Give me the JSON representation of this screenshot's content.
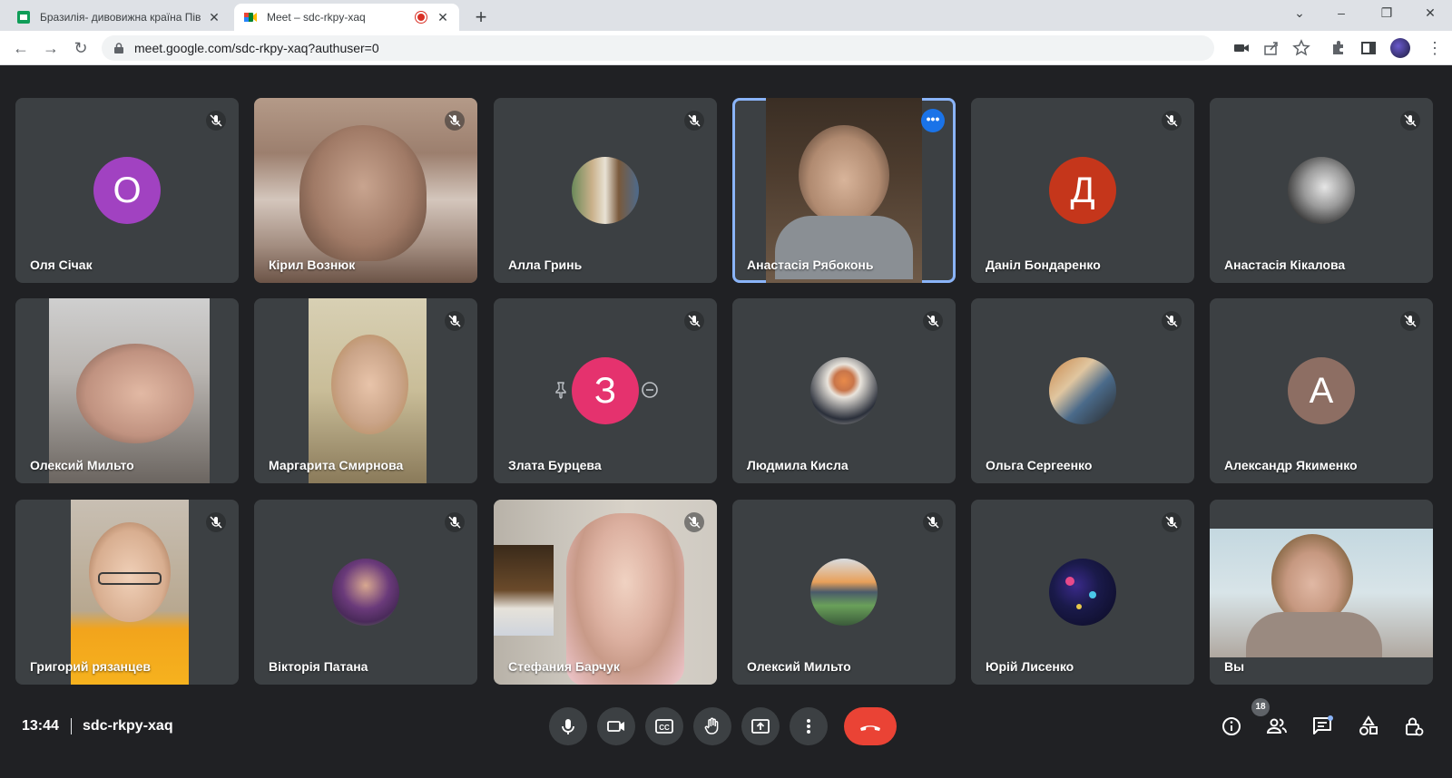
{
  "browser": {
    "tabs": [
      {
        "title": "Бразилія- дивовижна країна Пів",
        "active": false
      },
      {
        "title": "Meet – sdc-rkpy-xaq",
        "active": true
      }
    ],
    "url": "meet.google.com/sdc-rkpy-xaq?authuser=0"
  },
  "participants": [
    {
      "name": "Оля Січак",
      "type": "letter",
      "letter": "О",
      "color": "#a142c1",
      "muted": true
    },
    {
      "name": "Кірил Вознюк",
      "type": "video",
      "muted": true
    },
    {
      "name": "Алла Гринь",
      "type": "photo",
      "muted": true
    },
    {
      "name": "Анастасія Рябоконь",
      "type": "video",
      "muted": false,
      "speaking": true
    },
    {
      "name": "Даніл Бондаренко",
      "type": "letter",
      "letter": "Д",
      "color": "#c5361b",
      "muted": true
    },
    {
      "name": "Анастасія Кікалова",
      "type": "photo",
      "muted": true
    },
    {
      "name": "Олексий Мильто",
      "type": "video",
      "muted": false
    },
    {
      "name": "Маргарита Смирнова",
      "type": "video",
      "muted": true
    },
    {
      "name": "Злата Бурцева",
      "type": "letter",
      "letter": "З",
      "color": "#e5326e",
      "muted": true
    },
    {
      "name": "Людмила Кисла",
      "type": "photo",
      "muted": true
    },
    {
      "name": "Ольга Сергеенко",
      "type": "photo",
      "muted": true
    },
    {
      "name": "Александр Якименко",
      "type": "letter",
      "letter": "А",
      "color": "#8d6e63",
      "muted": true
    },
    {
      "name": "Григорий рязанцев",
      "type": "video",
      "muted": true
    },
    {
      "name": "Вікторія Патана",
      "type": "photo",
      "muted": true
    },
    {
      "name": "Стефания Барчук",
      "type": "video",
      "muted": true
    },
    {
      "name": "Олексий Мильто",
      "type": "photo",
      "muted": true
    },
    {
      "name": "Юрій Лисенко",
      "type": "photo",
      "muted": true
    },
    {
      "name": "Вы",
      "type": "video",
      "muted": false
    }
  ],
  "footer": {
    "time": "13:44",
    "meeting_code": "sdc-rkpy-xaq",
    "participants_count": "18"
  },
  "colors": {
    "background": "#202124",
    "tile": "#3c4043",
    "end_call": "#ea4335",
    "active_outline": "#8ab4f8"
  }
}
